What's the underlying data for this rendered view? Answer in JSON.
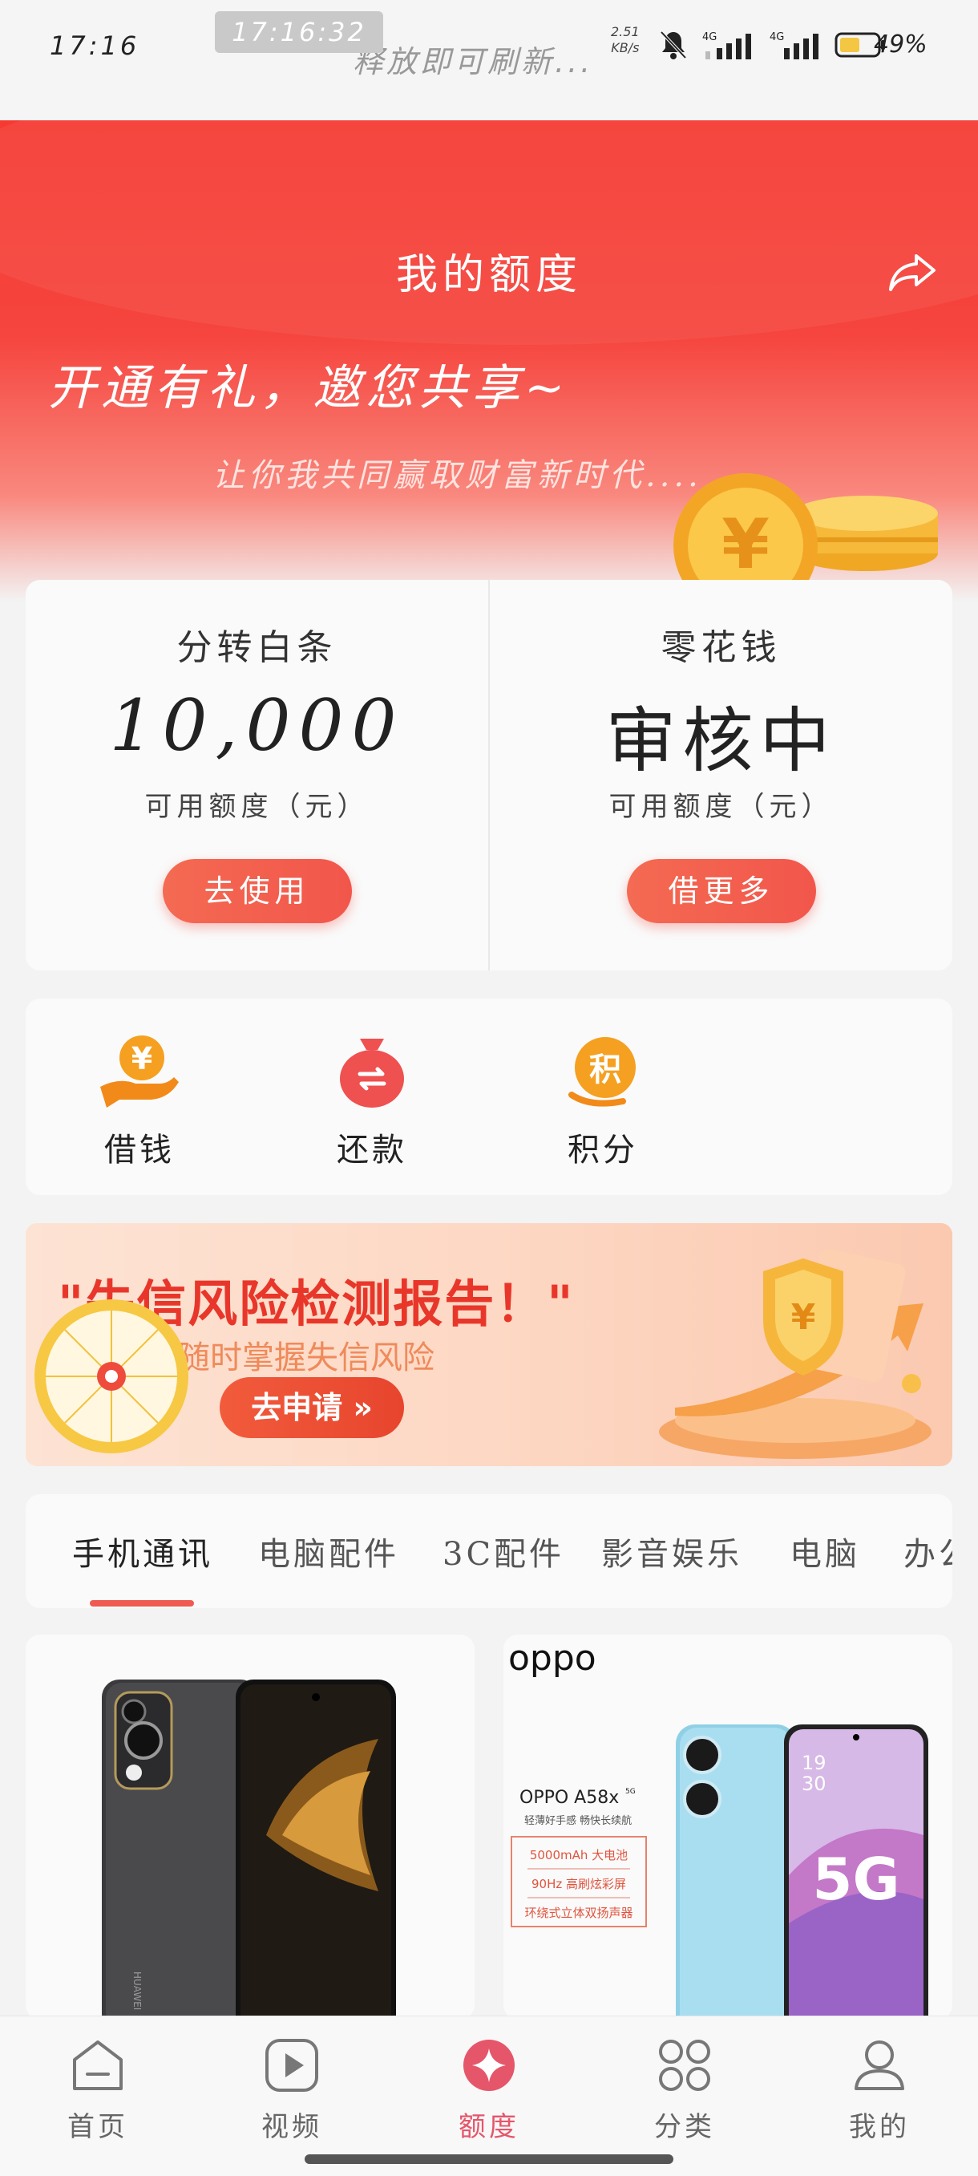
{
  "status_bar": {
    "time": "17:16",
    "clock_overlay": "17:16:32",
    "refresh_hint": "释放即可刷新...",
    "net_speed_value": "2.51",
    "net_speed_unit": "KB/s",
    "signal_1": "4G",
    "signal_2": "4G",
    "battery": "49%"
  },
  "header": {
    "title": "我的额度",
    "slogan": "开通有礼，邀您共享~",
    "subtitle": "让你我共同赢取财富新时代...."
  },
  "limits": [
    {
      "name": "分转白条",
      "value": "10,000",
      "unit_label": "可用额度（元）",
      "button": "去使用"
    },
    {
      "name": "零花钱",
      "value": "审核中",
      "unit_label": "可用额度（元）",
      "button": "借更多"
    }
  ],
  "quick_actions": [
    {
      "label": "借钱",
      "icon": "borrow-money-icon",
      "color": "#f5a020"
    },
    {
      "label": "还款",
      "icon": "repay-bag-icon",
      "color": "#ef5050"
    },
    {
      "label": "积分",
      "icon": "points-icon",
      "color": "#f5a020",
      "glyph": "积"
    }
  ],
  "promo": {
    "title": "\"失信风险检测报告！\"",
    "subtitle": "随时掌握失信风险",
    "button": "去申请 »"
  },
  "categories": {
    "tabs": [
      "手机通讯",
      "电脑配件",
      "3C配件",
      "影音娱乐",
      "电脑",
      "办公"
    ],
    "active": 0
  },
  "products": [
    {
      "brand_logo": "",
      "phone_brand_text": "HUAWEI"
    },
    {
      "brand_logo": "oppo",
      "model": "OPPO A58x",
      "model_sup": "5G",
      "tagline": "轻薄好手感 畅快长续航",
      "features": [
        "5000mAh 大电池",
        "90Hz 高刷炫彩屏",
        "环绕式立体双扬声器"
      ],
      "screen_time_h": "19",
      "screen_time_m": "30",
      "screen_badge": "5G"
    }
  ],
  "bottom_nav": [
    {
      "label": "首页",
      "icon": "home-icon"
    },
    {
      "label": "视频",
      "icon": "video-icon"
    },
    {
      "label": "额度",
      "icon": "quota-icon",
      "active": true
    },
    {
      "label": "分类",
      "icon": "category-icon"
    },
    {
      "label": "我的",
      "icon": "profile-icon"
    }
  ],
  "colors": {
    "brand_red": "#f53a32",
    "accent": "#ef5b52",
    "nav_active": "#e5566b",
    "promo_red": "#e8372a"
  }
}
